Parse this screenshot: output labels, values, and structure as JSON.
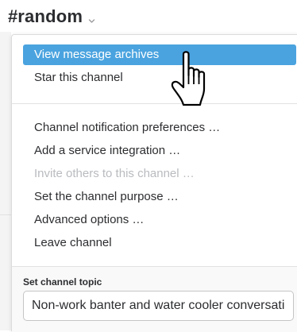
{
  "header": {
    "hash": "#",
    "channel_name": "random"
  },
  "menu": {
    "group_one": [
      {
        "label": "View message archives",
        "state": "highlighted"
      },
      {
        "label": "Star this channel",
        "state": "normal"
      }
    ],
    "group_two": [
      {
        "label": "Channel notification preferences …",
        "state": "normal"
      },
      {
        "label": "Add a service integration …",
        "state": "normal"
      },
      {
        "label": "Invite others to this channel …",
        "state": "disabled"
      },
      {
        "label": "Set the channel purpose …",
        "state": "normal"
      },
      {
        "label": "Advanced options …",
        "state": "normal"
      },
      {
        "label": "Leave channel",
        "state": "normal"
      }
    ]
  },
  "topic": {
    "label": "Set channel topic",
    "value": "Non-work banter and water cooler conversation"
  },
  "icons": {
    "caret": "chevron-down-icon",
    "cursor": "hand-pointer-cursor-icon"
  },
  "colors": {
    "highlight": "#4aa3df",
    "text": "#2c2d30",
    "disabled_text": "#b9bbbf"
  }
}
